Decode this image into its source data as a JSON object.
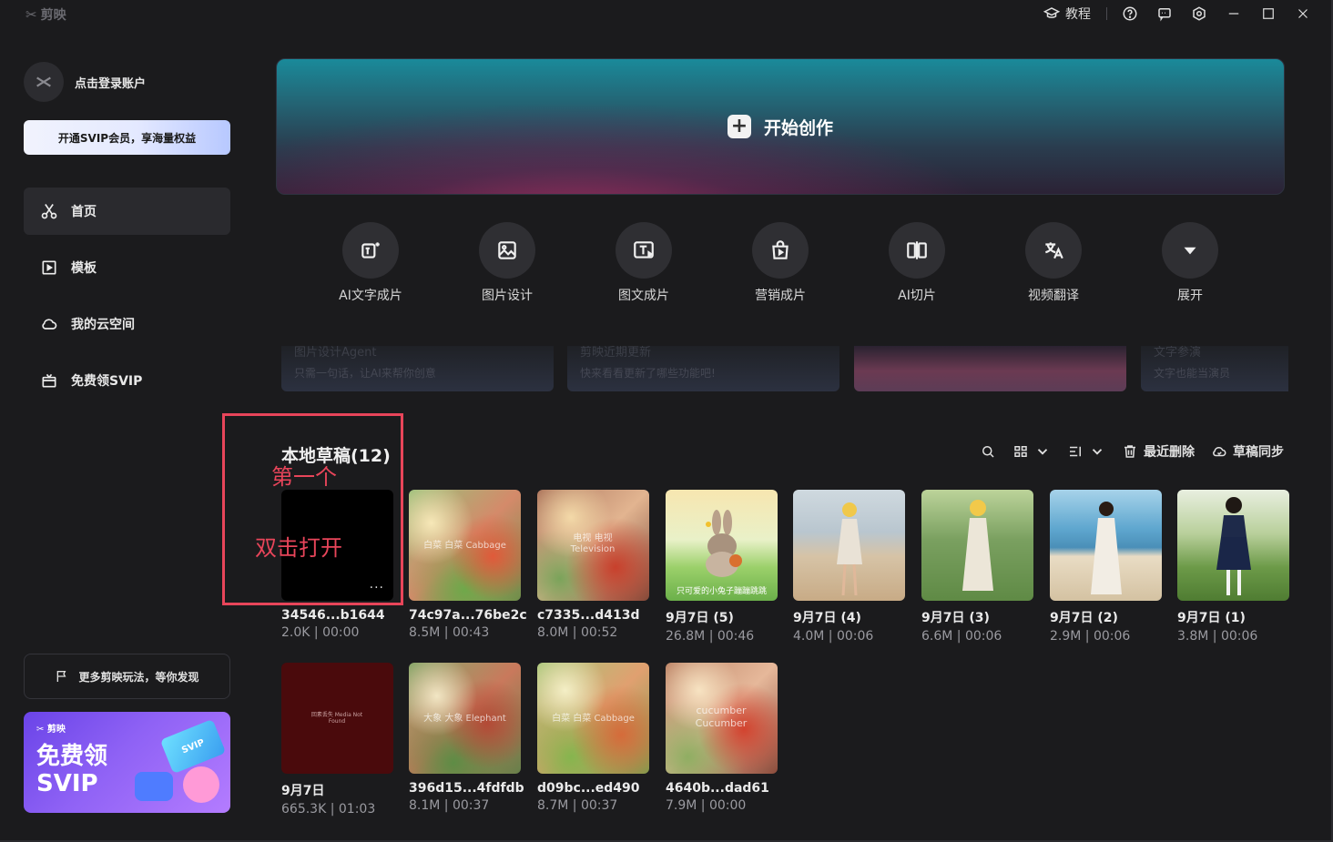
{
  "app": {
    "logo_text": "剪映"
  },
  "titlebar": {
    "tutorial_label": "教程",
    "icons": [
      "graduation-cap-icon",
      "help-icon",
      "feedback-icon",
      "settings-icon",
      "minimize-icon",
      "maximize-icon",
      "close-icon"
    ]
  },
  "sidebar": {
    "login_label": "点击登录账户",
    "svip_button": "开通SVIP会员，享海量权益",
    "nav": [
      {
        "label": "首页",
        "icon": "scissors-icon",
        "active": true
      },
      {
        "label": "模板",
        "icon": "template-icon",
        "active": false
      },
      {
        "label": "我的云空间",
        "icon": "cloud-icon",
        "active": false
      },
      {
        "label": "免费领SVIP",
        "icon": "gift-icon",
        "active": false
      }
    ],
    "more_label": "更多剪映玩法，等你发现",
    "promo": {
      "logo": "剪映",
      "title": "免费领SVIP",
      "card_text": "SVIP"
    }
  },
  "hero": {
    "label": "开始创作"
  },
  "tools": [
    {
      "label": "AI文字成片",
      "icon": "ai-text-video-icon"
    },
    {
      "label": "图片设计",
      "icon": "image-design-icon"
    },
    {
      "label": "图文成片",
      "icon": "text-image-video-icon"
    },
    {
      "label": "营销成片",
      "icon": "shopping-bag-icon"
    },
    {
      "label": "AI切片",
      "icon": "ai-slice-icon"
    },
    {
      "label": "视频翻译",
      "icon": "translate-icon"
    },
    {
      "label": "展开",
      "icon": "chevron-down-icon"
    }
  ],
  "banners": [
    {
      "title": "图片设计Agent",
      "subtitle": "只需一句话，让AI来帮你创意"
    },
    {
      "title": "剪映近期更新",
      "subtitle": "快来看看更新了哪些功能吧!"
    },
    {
      "title": "",
      "subtitle": ""
    },
    {
      "title": "文字参演",
      "subtitle": "文字也能当演员"
    }
  ],
  "drafts": {
    "title": "本地草稿(12)",
    "recent_delete": "最近删除",
    "sync": "草稿同步",
    "items": [
      {
        "name": "34546...b1644",
        "meta": "2.0K | 00:00",
        "thumb": "black",
        "overlay": ""
      },
      {
        "name": "74c97a...76be2c",
        "meta": "8.5M | 00:43",
        "thumb": "blur1",
        "overlay": "白菜 白菜 Cabbage"
      },
      {
        "name": "c7335...d413d",
        "meta": "8.0M | 00:52",
        "thumb": "blur2",
        "overlay": "电视 电视 Television"
      },
      {
        "name": "9月7日 (5)",
        "meta": "26.8M | 00:46",
        "thumb": "bunny",
        "overlay": "只可爱的小兔子蹦蹦跳跳"
      },
      {
        "name": "9月7日 (4)",
        "meta": "4.0M | 00:06",
        "thumb": "beach1",
        "overlay": ""
      },
      {
        "name": "9月7日 (3)",
        "meta": "6.6M | 00:06",
        "thumb": "field",
        "overlay": ""
      },
      {
        "name": "9月7日 (2)",
        "meta": "2.9M | 00:06",
        "thumb": "beach2",
        "overlay": ""
      },
      {
        "name": "9月7日 (1)",
        "meta": "3.8M | 00:06",
        "thumb": "park",
        "overlay": ""
      },
      {
        "name": "9月7日",
        "meta": "665.3K | 01:03",
        "thumb": "darkred",
        "overlay": "回素丢失 Media Not Found"
      },
      {
        "name": "396d15...4fdfdb",
        "meta": "8.1M | 00:37",
        "thumb": "blur3",
        "overlay": "大象 大象 Elephant"
      },
      {
        "name": "d09bc...ed490",
        "meta": "8.7M | 00:37",
        "thumb": "blur4",
        "overlay": "白菜 白菜 Cabbage"
      },
      {
        "name": "4640b...dad61",
        "meta": "7.9M | 00:00",
        "thumb": "blur5",
        "overlay": "cucumber Cucumber"
      }
    ]
  },
  "annotation": {
    "first_label": "第一个",
    "action_label": "双击打开",
    "color": "#e8455a"
  }
}
